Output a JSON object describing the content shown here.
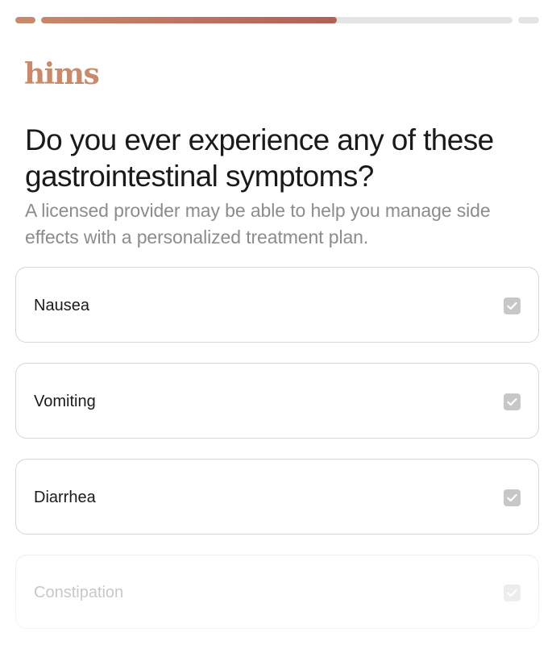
{
  "progress": {
    "segments": [
      {
        "fill": 1.0
      },
      {
        "fill": 0.627
      },
      {
        "fill": 0.0
      }
    ],
    "colors": {
      "start": "#c98a6b",
      "end": "#a5454a",
      "track": "#e4e4e4"
    }
  },
  "brand": {
    "logo_text": "hims",
    "logo_color": "#c98a6b"
  },
  "question": {
    "title": "Do you ever experience any of these gastrointestinal symptoms?",
    "subtitle": "A licensed provider may be able to help you manage side effects with a personalized treatment plan."
  },
  "options": [
    {
      "label": "Nausea",
      "icon": "checkmark-icon"
    },
    {
      "label": "Vomiting",
      "icon": "checkmark-icon"
    },
    {
      "label": "Diarrhea",
      "icon": "checkmark-icon"
    },
    {
      "label": "Constipation",
      "icon": "checkmark-icon"
    }
  ]
}
